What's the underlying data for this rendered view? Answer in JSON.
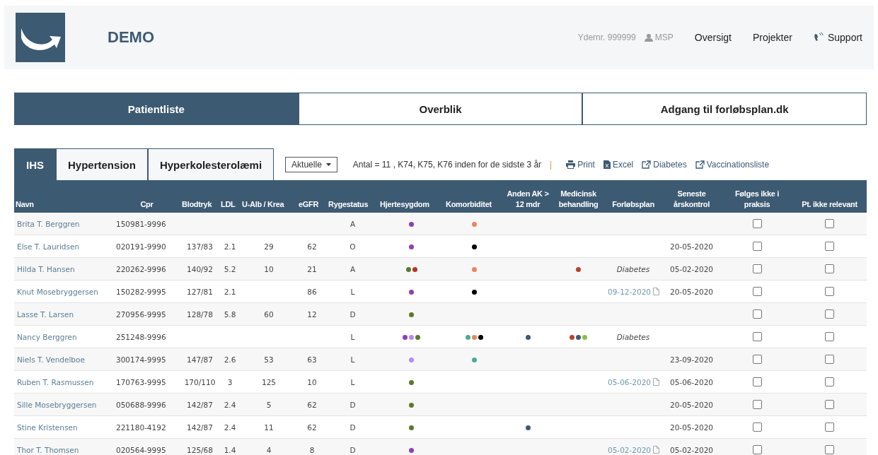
{
  "header": {
    "title": "DEMO",
    "provider": "Ydernr. 999999",
    "user": "MSP",
    "nav": [
      "Oversigt",
      "Projekter"
    ],
    "support": "Support"
  },
  "main_tabs": [
    {
      "label": "Patientliste",
      "selected": true
    },
    {
      "label": "Overblik",
      "selected": false
    },
    {
      "label": "Adgang til forløbsplan.dk",
      "selected": false
    }
  ],
  "sub_tabs": [
    {
      "label": "IHS",
      "selected": true
    },
    {
      "label": "Hypertension",
      "selected": false
    },
    {
      "label": "Hyperkolesterolæmi",
      "selected": false
    }
  ],
  "filter": {
    "value": "Aktuelle"
  },
  "summary": "Antal = 11 , K74, K75, K76 inden for de sidste 3 år",
  "separator": "|",
  "actions": [
    {
      "kind": "print",
      "label": "Print"
    },
    {
      "kind": "excel",
      "label": "Excel"
    },
    {
      "kind": "external",
      "label": "Diabetes"
    },
    {
      "kind": "external",
      "label": "Vaccinationsliste"
    }
  ],
  "table": {
    "columns": [
      {
        "label": "Navn"
      },
      {
        "label": "Cpr"
      },
      {
        "label": "Blodtryk"
      },
      {
        "label": "LDL"
      },
      {
        "label": "U-Alb / Krea"
      },
      {
        "label": "eGFR"
      },
      {
        "label": "Rygestatus"
      },
      {
        "label": "Hjertesygdom"
      },
      {
        "label": "Komorbiditet"
      },
      {
        "label": "Anden AK > 12 mdr"
      },
      {
        "label": "Medicinsk behandling"
      },
      {
        "label": "Forløbsplan"
      },
      {
        "label": "Seneste årskontrol"
      },
      {
        "label": "Følges ikke i praksis"
      },
      {
        "label": "Pt. ikke relevant"
      }
    ],
    "rows": [
      {
        "navn": "Brita T. Berggren",
        "cpr": "150981-9996",
        "blodtryk": "",
        "ldl": "",
        "ualb": "",
        "egfr": "",
        "ryge": "A",
        "hjerte": [
          {
            "color": "#8e3fb5"
          }
        ],
        "komorb": [
          {
            "color": "#e8865f"
          }
        ],
        "anden": [],
        "medicinsk": [],
        "forlob": null,
        "seneste": "",
        "folges_checked": false,
        "relevant_checked": false
      },
      {
        "navn": "Else T. Lauridsen",
        "cpr": "020191-9990",
        "blodtryk": "137/83",
        "ldl": "2.1",
        "ualb": "29",
        "egfr": "62",
        "ryge": "O",
        "hjerte": [
          {
            "color": "#8e3fb5"
          }
        ],
        "komorb": [
          {
            "color": "#000000"
          }
        ],
        "anden": [],
        "medicinsk": [],
        "forlob": null,
        "seneste": "20-05-2020",
        "folges_checked": false,
        "relevant_checked": false
      },
      {
        "navn": "Hilda T. Hansen",
        "cpr": "220262-9996",
        "blodtryk": "140/92",
        "ldl": "5.2",
        "ualb": "10",
        "egfr": "21",
        "ryge": "A",
        "hjerte": [
          {
            "color": "#5a7a2e"
          },
          {
            "color": "#c0302a"
          }
        ],
        "komorb": [
          {
            "color": "#e8865f"
          }
        ],
        "anden": [],
        "medicinsk": [
          {
            "color": "#b5432e"
          }
        ],
        "forlob": {
          "kind": "note",
          "text": "Diabetes"
        },
        "seneste": "05-02-2020",
        "folges_checked": false,
        "relevant_checked": false
      },
      {
        "navn": "Knut Mosebryggersen",
        "cpr": "150282-9995",
        "blodtryk": "127/81",
        "ldl": "2.1",
        "ualb": "",
        "egfr": "86",
        "ryge": "L",
        "hjerte": [
          {
            "color": "#8e3fb5"
          }
        ],
        "komorb": [
          {
            "color": "#000000"
          }
        ],
        "anden": [],
        "medicinsk": [],
        "forlob": {
          "kind": "link",
          "text": "09-12-2020"
        },
        "seneste": "20-05-2020",
        "folges_checked": false,
        "relevant_checked": false
      },
      {
        "navn": "Lasse T. Larsen",
        "cpr": "270956-9995",
        "blodtryk": "128/78",
        "ldl": "5.8",
        "ualb": "60",
        "egfr": "12",
        "ryge": "D",
        "hjerte": [
          {
            "color": "#5a7a2e"
          }
        ],
        "komorb": [],
        "anden": [],
        "medicinsk": [],
        "forlob": null,
        "seneste": "",
        "folges_checked": false,
        "relevant_checked": false
      },
      {
        "navn": "Nancy Berggren",
        "cpr": "251248-9996",
        "blodtryk": "",
        "ldl": "",
        "ualb": "",
        "egfr": "",
        "ryge": "L",
        "hjerte": [
          {
            "color": "#8e3fb5"
          },
          {
            "color": "#b38de6"
          },
          {
            "color": "#5a7a2e"
          }
        ],
        "komorb": [
          {
            "color": "#4aab96"
          },
          {
            "color": "#e8865f"
          },
          {
            "color": "#000000"
          }
        ],
        "anden": [
          {
            "color": "#3e5a78"
          }
        ],
        "medicinsk": [
          {
            "color": "#b5432e"
          },
          {
            "color": "#3e5a78"
          },
          {
            "color": "#8bbd45"
          }
        ],
        "forlob": {
          "kind": "note",
          "text": "Diabetes"
        },
        "seneste": "",
        "folges_checked": false,
        "relevant_checked": false
      },
      {
        "navn": "Niels T. Vendelboe",
        "cpr": "300174-9995",
        "blodtryk": "147/87",
        "ldl": "2.6",
        "ualb": "53",
        "egfr": "63",
        "ryge": "L",
        "hjerte": [
          {
            "color": "#b38de6"
          }
        ],
        "komorb": [
          {
            "color": "#4aab96"
          }
        ],
        "anden": [],
        "medicinsk": [],
        "forlob": null,
        "seneste": "23-09-2020",
        "folges_checked": false,
        "relevant_checked": false
      },
      {
        "navn": "Ruben T. Rasmussen",
        "cpr": "170763-9995",
        "blodtryk": "170/110",
        "ldl": "3",
        "ualb": "125",
        "egfr": "10",
        "ryge": "L",
        "hjerte": [
          {
            "color": "#5a7a2e"
          }
        ],
        "komorb": [],
        "anden": [],
        "medicinsk": [],
        "forlob": {
          "kind": "link",
          "text": "05-06-2020"
        },
        "seneste": "05-06-2020",
        "folges_checked": false,
        "relevant_checked": false
      },
      {
        "navn": "Sille Mosebryggersen",
        "cpr": "050688-9996",
        "blodtryk": "142/87",
        "ldl": "2.4",
        "ualb": "5",
        "egfr": "62",
        "ryge": "D",
        "hjerte": [
          {
            "color": "#5a7a2e"
          }
        ],
        "komorb": [],
        "anden": [],
        "medicinsk": [],
        "forlob": null,
        "seneste": "20-05-2020",
        "folges_checked": false,
        "relevant_checked": false
      },
      {
        "navn": "Stine Kristensen",
        "cpr": "221180-4192",
        "blodtryk": "142/87",
        "ldl": "2.4",
        "ualb": "11",
        "egfr": "62",
        "ryge": "D",
        "hjerte": [
          {
            "color": "#5a7a2e"
          }
        ],
        "komorb": [],
        "anden": [
          {
            "color": "#3e5a78"
          }
        ],
        "medicinsk": [],
        "forlob": null,
        "seneste": "20-05-2020",
        "folges_checked": false,
        "relevant_checked": false
      },
      {
        "navn": "Thor T. Thomsen",
        "cpr": "020564-9995",
        "blodtryk": "125/68",
        "ldl": "1.4",
        "ualb": "4",
        "egfr": "8",
        "ryge": "D",
        "hjerte": [
          {
            "color": "#8e3fb5"
          }
        ],
        "komorb": [],
        "anden": [],
        "medicinsk": [],
        "forlob": {
          "kind": "link",
          "text": "05-02-2020"
        },
        "seneste": "05-02-2020",
        "folges_checked": false,
        "relevant_checked": false
      }
    ]
  }
}
